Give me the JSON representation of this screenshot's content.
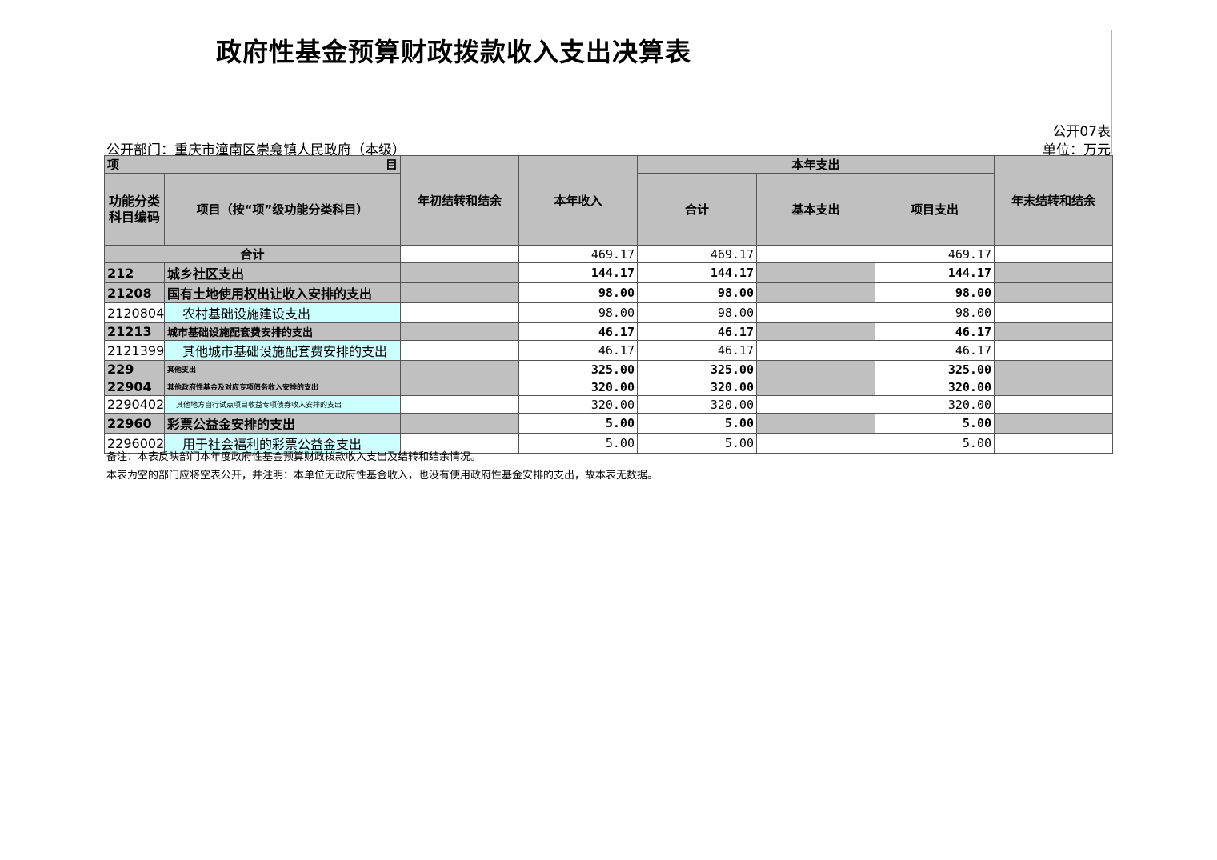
{
  "title": "政府性基金预算财政拨款收入支出决算表",
  "table_no": "公开07表",
  "unit": "单位：万元",
  "department": "公开部门：重庆市潼南区崇龛镇人民政府（本级）",
  "headers": {
    "item_left": "项",
    "item_right": "目",
    "code": "功能分类科目编码",
    "name": "项目（按“项”级功能分类科目）",
    "opening": "年初结转和结余",
    "income": "本年收入",
    "expense_group": "本年支出",
    "total": "合计",
    "basic": "基本支出",
    "project": "项目支出",
    "closing": "年末结转和结余"
  },
  "total_row": {
    "label": "合计",
    "opening": "",
    "income": "469.17",
    "total": "469.17",
    "basic": "",
    "project": "469.17",
    "closing": ""
  },
  "rows": [
    {
      "code": "212",
      "name": "城乡社区支出",
      "opening": "",
      "income": "144.17",
      "total": "144.17",
      "basic": "",
      "project": "144.17",
      "closing": ""
    },
    {
      "code": "21208",
      "name": "国有土地使用权出让收入安排的支出",
      "opening": "",
      "income": "98.00",
      "total": "98.00",
      "basic": "",
      "project": "98.00",
      "closing": ""
    },
    {
      "code": "2120804",
      "name": "农村基础设施建设支出",
      "opening": "",
      "income": "98.00",
      "total": "98.00",
      "basic": "",
      "project": "98.00",
      "closing": ""
    },
    {
      "code": "21213",
      "name": "城市基础设施配套费安排的支出",
      "opening": "",
      "income": "46.17",
      "total": "46.17",
      "basic": "",
      "project": "46.17",
      "closing": ""
    },
    {
      "code": "2121399",
      "name": "其他城市基础设施配套费安排的支出",
      "opening": "",
      "income": "46.17",
      "total": "46.17",
      "basic": "",
      "project": "46.17",
      "closing": ""
    },
    {
      "code": "229",
      "name": "其他支出",
      "opening": "",
      "income": "325.00",
      "total": "325.00",
      "basic": "",
      "project": "325.00",
      "closing": ""
    },
    {
      "code": "22904",
      "name": "其他政府性基金及对应专项债务收入安排的支出",
      "opening": "",
      "income": "320.00",
      "total": "320.00",
      "basic": "",
      "project": "320.00",
      "closing": ""
    },
    {
      "code": "2290402",
      "name": "其他地方自行试点项目收益专项债券收入安排的支出",
      "opening": "",
      "income": "320.00",
      "total": "320.00",
      "basic": "",
      "project": "320.00",
      "closing": ""
    },
    {
      "code": "22960",
      "name": "彩票公益金安排的支出",
      "opening": "",
      "income": "5.00",
      "total": "5.00",
      "basic": "",
      "project": "5.00",
      "closing": ""
    },
    {
      "code": "2296002",
      "name": "用于社会福利的彩票公益金支出",
      "opening": "",
      "income": "5.00",
      "total": "5.00",
      "basic": "",
      "project": "5.00",
      "closing": ""
    }
  ],
  "notes": [
    "备注：本表反映部门本年度政府性基金预算财政拨款收入支出及结转和结余情况。",
    "本表为空的部门应将空表公开，并注明：本单位无政府性基金收入，也没有使用政府性基金安排的支出，故本表无数据。"
  ]
}
